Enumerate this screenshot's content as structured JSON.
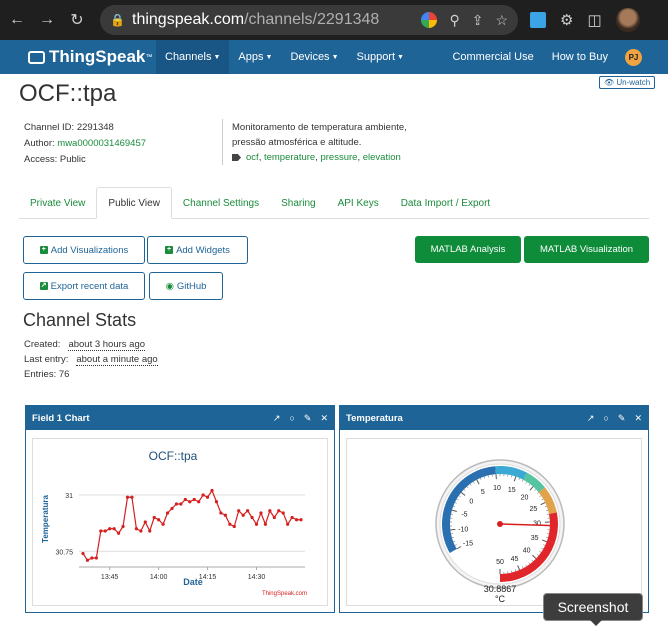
{
  "browser": {
    "url_host": "thingspeak.com",
    "url_path": "/channels/2291348"
  },
  "nav": {
    "logo": "ThingSpeak",
    "logo_tm": "™",
    "items": [
      {
        "label": "Channels",
        "active": true
      },
      {
        "label": "Apps"
      },
      {
        "label": "Devices"
      },
      {
        "label": "Support"
      }
    ],
    "right": {
      "commercial": "Commercial Use",
      "buy": "How to Buy",
      "user_initials": "PJ"
    }
  },
  "channel": {
    "title": "OCF::tpa",
    "unwatch_label": "Un-watch",
    "id_label": "Channel ID:",
    "id_value": "2291348",
    "author_label": "Author:",
    "author_value": "mwa0000031469457",
    "access_label": "Access:",
    "access_value": "Public",
    "description_line1": "Monitoramento de temperatura ambiente,",
    "description_line2": "pressão atmosférica e altitude.",
    "tags": [
      "ocf",
      "temperature",
      "pressure",
      "elevation"
    ]
  },
  "tabs": [
    "Private View",
    "Public View",
    "Channel Settings",
    "Sharing",
    "API Keys",
    "Data Import / Export"
  ],
  "buttons": {
    "add_visualizations": "Add Visualizations",
    "add_widgets": "Add Widgets",
    "export_recent": "Export recent data",
    "github": "GitHub",
    "matlab_analysis": "MATLAB Analysis",
    "matlab_visualization": "MATLAB Visualization"
  },
  "stats": {
    "title": "Channel Stats",
    "created_label": "Created:",
    "created_value": "about 3 hours ago",
    "last_entry_label": "Last entry:",
    "last_entry_value": "about a minute ago",
    "entries_label": "Entries:",
    "entries_value": "76"
  },
  "chart_widget": {
    "header": "Field 1 Chart"
  },
  "gauge_widget": {
    "header": "Temperatura",
    "value": "30.8867",
    "unit": "°C"
  },
  "chart_data": {
    "type": "line",
    "title": "OCF::tpa",
    "xlabel": "Date",
    "ylabel": "Temperatura",
    "credit": "ThingSpeak.com",
    "x_tick_labels": [
      "13:45",
      "14:00",
      "14:15",
      "14:30"
    ],
    "y_tick_labels": [
      "30.75",
      "31"
    ],
    "ylim": [
      30.68,
      31.08
    ],
    "color": "#d62020",
    "values": [
      30.74,
      30.71,
      30.72,
      30.72,
      30.84,
      30.84,
      30.85,
      30.85,
      30.83,
      30.86,
      30.99,
      30.99,
      30.85,
      30.84,
      30.88,
      30.84,
      30.9,
      30.89,
      30.87,
      30.92,
      30.94,
      30.96,
      30.96,
      30.98,
      30.97,
      30.98,
      30.97,
      31.0,
      30.99,
      31.02,
      30.97,
      30.92,
      30.91,
      30.87,
      30.86,
      30.93,
      30.91,
      30.93,
      30.9,
      30.87,
      30.92,
      30.87,
      30.93,
      30.9,
      30.93,
      30.92,
      30.87,
      30.9,
      30.89,
      30.89
    ]
  },
  "gauge": {
    "min": -15,
    "max": 50,
    "value": 30.8867,
    "tick_labels": [
      "-15",
      "-10",
      "-5",
      "0",
      "5",
      "10",
      "15",
      "20",
      "25",
      "30",
      "35",
      "40",
      "45",
      "50"
    ],
    "colors": {
      "cold": "#2a6fb0",
      "mild": "#3aaad4",
      "ok": "#56c4a0",
      "warm": "#e0a24a",
      "hot": "#e0262b"
    }
  },
  "tooltip": "Screenshot"
}
